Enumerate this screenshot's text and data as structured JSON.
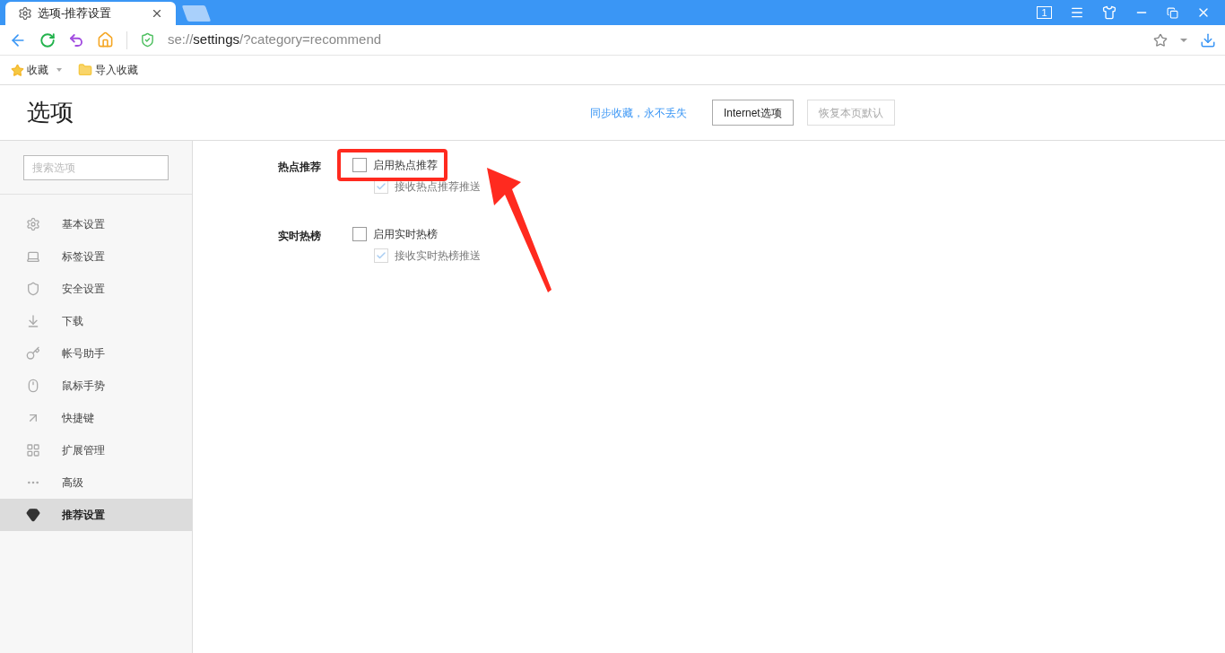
{
  "tabs": [
    {
      "title": "选项-推荐设置",
      "selected": true
    }
  ],
  "window_controls": {
    "tab_count": "1"
  },
  "address_bar": {
    "scheme": "se://",
    "host": "settings",
    "path": "/?category=recommend"
  },
  "bookmarks": [
    {
      "label": "收藏",
      "kind": "favorites"
    },
    {
      "label": "导入收藏",
      "kind": "folder"
    }
  ],
  "header": {
    "title": "选项",
    "sync_link": "同步收藏，永不丢失",
    "buttons": [
      {
        "label": "Internet选项",
        "disabled": false
      },
      {
        "label": "恢复本页默认",
        "disabled": true
      }
    ]
  },
  "sidebar": {
    "search": {
      "placeholder": "搜索选项"
    },
    "items": [
      {
        "label": "基本设置",
        "selected": false
      },
      {
        "label": "标签设置",
        "selected": false
      },
      {
        "label": "安全设置",
        "selected": false
      },
      {
        "label": "下载",
        "selected": false
      },
      {
        "label": "帐号助手",
        "selected": false
      },
      {
        "label": "鼠标手势",
        "selected": false
      },
      {
        "label": "快捷键",
        "selected": false
      },
      {
        "label": "扩展管理",
        "selected": false
      },
      {
        "label": "高级",
        "selected": false
      },
      {
        "label": "推荐设置",
        "selected": true
      }
    ]
  },
  "sections": [
    {
      "title": "热点推荐",
      "highlighted": true,
      "options": [
        {
          "label": "启用热点推荐",
          "checked": false,
          "disabled": false,
          "children": [
            {
              "label": "接收热点推荐推送",
              "checked": true,
              "disabled": true
            }
          ]
        }
      ]
    },
    {
      "title": "实时热榜",
      "highlighted": false,
      "options": [
        {
          "label": "启用实时热榜",
          "checked": false,
          "disabled": false,
          "children": [
            {
              "label": "接收实时热榜推送",
              "checked": true,
              "disabled": true
            }
          ]
        }
      ]
    }
  ]
}
